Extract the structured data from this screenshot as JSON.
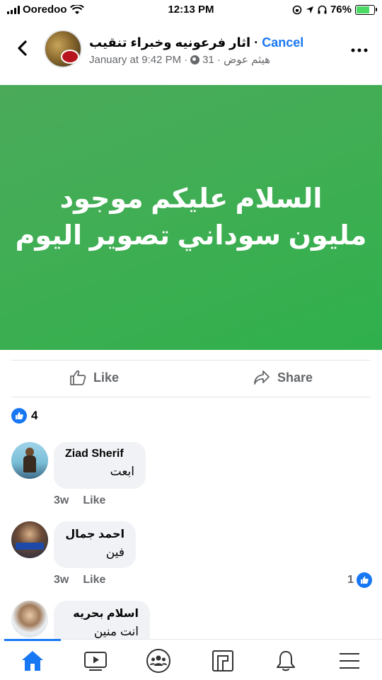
{
  "status_bar": {
    "carrier": "Ooredoo",
    "time": "12:13 PM",
    "battery": "76%",
    "battery_level": 0.76
  },
  "header": {
    "cancel_label": "Cancel",
    "group_name": "اثار فرعونيه وخبراء تنقيب ·",
    "date": "January at 9:42 PM",
    "separator": "·",
    "author": "31 · هيثم عوض"
  },
  "post": {
    "line1": "السلام عليكم موجود",
    "line2": "مليون سوداني تصوير اليوم",
    "background_color": "#3fae53"
  },
  "actions": {
    "like_label": "Like",
    "share_label": "Share"
  },
  "reactions": {
    "count": "4"
  },
  "comments": [
    {
      "name": "Ziad Sherif",
      "text": "ابعت",
      "time": "3w",
      "like_label": "Like"
    },
    {
      "name": "احمد جمال",
      "text": "فين",
      "time": "3w",
      "like_label": "Like",
      "reactions": "1"
    },
    {
      "name": "اسلام بحريه",
      "text": "انت منين"
    }
  ],
  "nav": {
    "items": [
      "home-icon",
      "video-icon",
      "groups-icon",
      "pages-icon",
      "notifications-icon",
      "menu-icon"
    ],
    "accent": "#1877f2"
  }
}
